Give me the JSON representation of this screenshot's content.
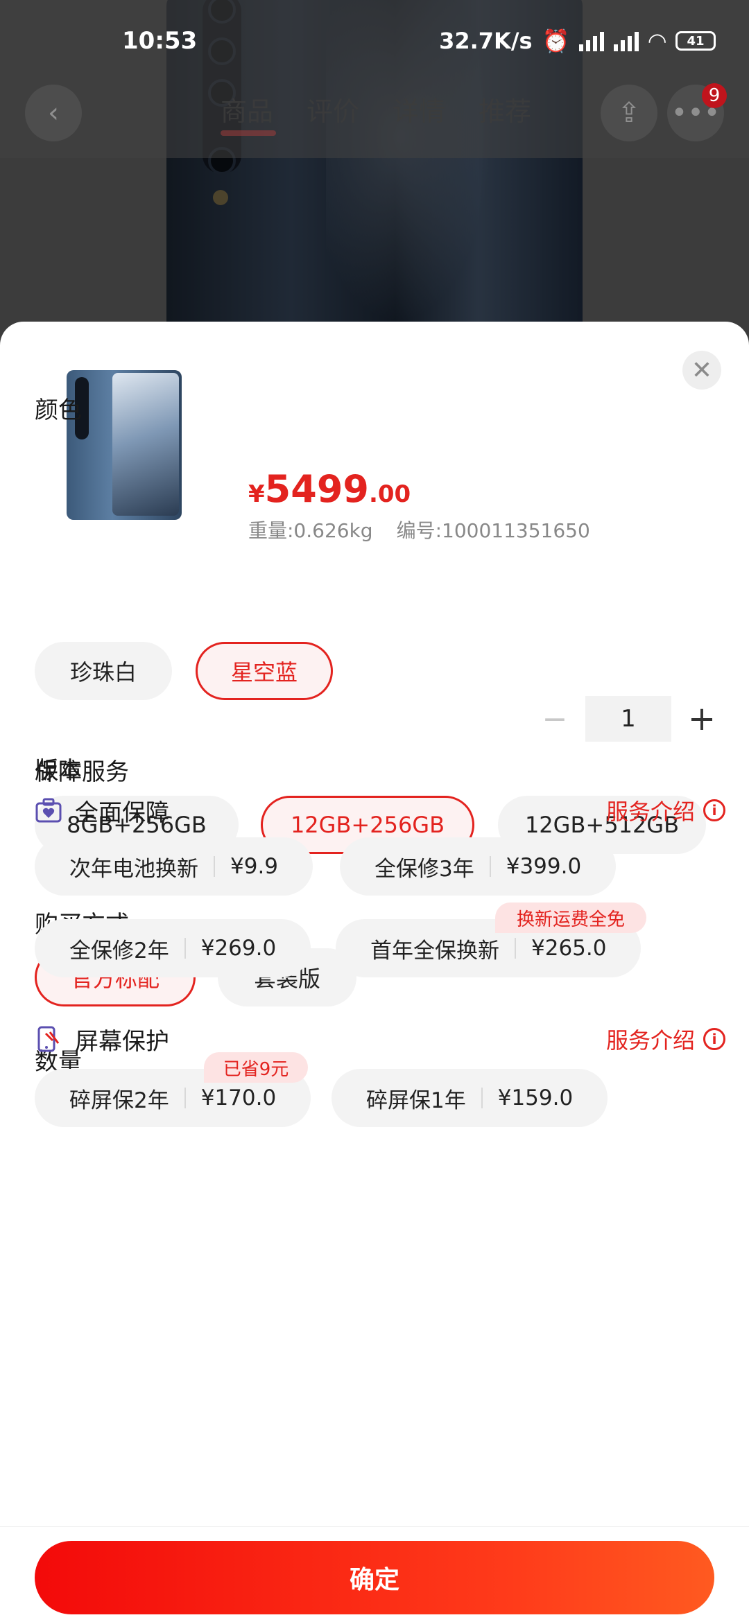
{
  "status_bar": {
    "time": "10:53",
    "net_speed": "32.7K/s",
    "battery": "41"
  },
  "page_tabs": [
    "商品",
    "评价",
    "详情",
    "推荐"
  ],
  "cart_badge": "9",
  "product": {
    "price_symbol": "¥",
    "price_int": "5499",
    "price_dec": ".00",
    "weight": "重量:0.626kg",
    "sku": "编号:100011351650"
  },
  "color": {
    "title": "颜色",
    "options": [
      "珍珠白",
      "星空蓝"
    ],
    "selected": "星空蓝"
  },
  "version": {
    "title": "版本",
    "options": [
      "8GB+256GB",
      "12GB+256GB",
      "12GB+512GB"
    ],
    "selected": "12GB+256GB"
  },
  "purchase": {
    "title": "购买方式",
    "options": [
      "官方标配",
      "套装版"
    ],
    "selected": "官方标配"
  },
  "quantity": {
    "title": "数量",
    "minus": "−",
    "value": "1",
    "plus": "+"
  },
  "guarantee": {
    "title": "保障服务",
    "full": {
      "title": "全面保障",
      "link": "服务介绍",
      "items": [
        {
          "name": "次年电池换新",
          "price": "¥9.9"
        },
        {
          "name": "全保修3年",
          "price": "¥399.0"
        },
        {
          "name": "全保修2年",
          "price": "¥269.0"
        },
        {
          "name": "首年全保换新",
          "price": "¥265.0",
          "tag": "换新运费全免"
        }
      ]
    },
    "screen": {
      "title": "屏幕保护",
      "link": "服务介绍",
      "items": [
        {
          "name": "碎屏保2年",
          "price": "¥170.0",
          "tag": "已省9元"
        },
        {
          "name": "碎屏保1年",
          "price": "¥159.0"
        }
      ]
    }
  },
  "confirm_label": "确定",
  "colors": {
    "accent": "#e3231f",
    "chip_bg": "#f3f3f3",
    "selected_bg": "#fdf2f2"
  },
  "icons": [
    "back-icon",
    "share-icon",
    "more-icon",
    "close-icon",
    "shield-bag-icon",
    "phone-screen-icon",
    "info-icon"
  ]
}
